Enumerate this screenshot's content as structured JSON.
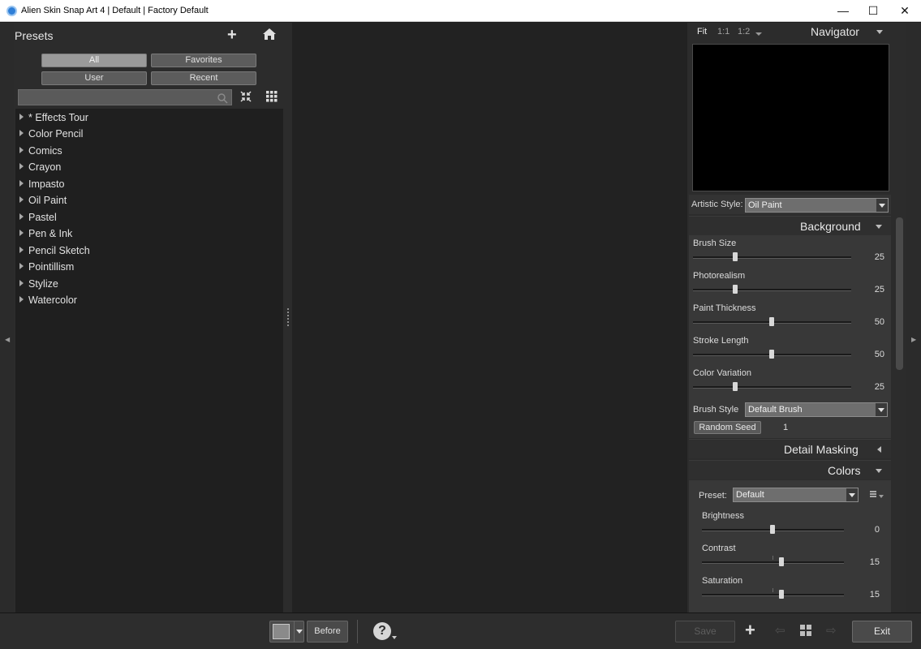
{
  "window": {
    "title": "Alien Skin Snap Art 4 | Default | Factory Default",
    "controls": {
      "minimize": "—",
      "maximize": "☐",
      "close": "✕"
    }
  },
  "presets": {
    "title": "Presets",
    "filters": [
      "All",
      "Favorites",
      "User",
      "Recent"
    ],
    "active_filter": "All",
    "search": {
      "value": "",
      "placeholder": ""
    },
    "items": [
      "* Effects Tour",
      "Color Pencil",
      "Comics",
      "Crayon",
      "Impasto",
      "Oil Paint",
      "Pastel",
      "Pen & Ink",
      "Pencil Sketch",
      "Pointillism",
      "Stylize",
      "Watercolor"
    ]
  },
  "navigator": {
    "zoom_options": [
      "Fit",
      "1:1",
      "1:2"
    ],
    "active_zoom": "Fit",
    "title": "Navigator"
  },
  "artistic_style": {
    "label": "Artistic Style:",
    "value": "Oil Paint"
  },
  "background": {
    "title": "Background",
    "sliders": [
      {
        "label": "Brush Size",
        "value": 25,
        "display": "25"
      },
      {
        "label": "Photorealism",
        "value": 25,
        "display": "25"
      },
      {
        "label": "Paint Thickness",
        "value": 50,
        "display": "50"
      },
      {
        "label": "Stroke Length",
        "value": 50,
        "display": "50"
      },
      {
        "label": "Color Variation",
        "value": 25,
        "display": "25"
      }
    ],
    "brush_style": {
      "label": "Brush Style",
      "value": "Default Brush"
    },
    "random_seed": {
      "button": "Random Seed",
      "value": "1"
    }
  },
  "detail_masking": {
    "title": "Detail Masking"
  },
  "colors": {
    "title": "Colors",
    "preset": {
      "label": "Preset:",
      "value": "Default"
    },
    "sliders": [
      {
        "label": "Brightness",
        "value": 0,
        "display": "0",
        "min": -50,
        "max": 50
      },
      {
        "label": "Contrast",
        "value": 15,
        "display": "15",
        "min": -100,
        "max": 100
      },
      {
        "label": "Saturation",
        "value": 15,
        "display": "15",
        "min": -100,
        "max": 100
      }
    ]
  },
  "bottom_bar": {
    "before": "Before",
    "help": "?",
    "save": "Save",
    "add": "+",
    "exit": "Exit"
  },
  "icons": {
    "add": "plus-icon",
    "home": "home-icon",
    "search": "search-icon",
    "collapse": "collapse-icon",
    "grid": "grid-icon",
    "help": "help-icon"
  },
  "colors_theme": {
    "panel": "#2c2c2c",
    "canvas": "#222222",
    "button": "#5c5c5c",
    "active_button": "#9a9a9a"
  }
}
